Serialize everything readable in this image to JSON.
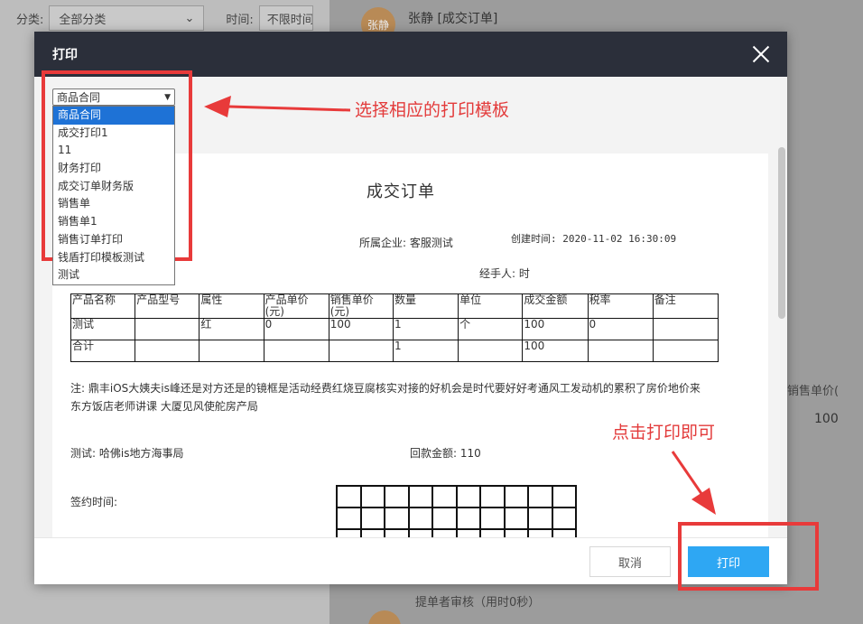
{
  "background": {
    "filter_label": "分类:",
    "filter_value": "全部分类",
    "time_label": "时间:",
    "time_value": "不限时间",
    "avatar_text": "张静",
    "user_title": "张静 [成交订单]",
    "col_header": "销售单价(",
    "col_value": "100",
    "audit_text": "提单者审核（用时0秒）"
  },
  "modal": {
    "title": "打印",
    "template_select": {
      "value": "商品合同",
      "options": [
        "商品合同",
        "成交打印1",
        "11",
        "财务打印",
        "成交订单财务版",
        "销售单",
        "销售单1",
        "销售订单打印",
        "钱盾打印模板测试",
        "测试"
      ]
    },
    "document": {
      "title": "成交订单",
      "company": "所属企业: 客服测试",
      "created": "创建时间: 2020-11-02 16:30:09",
      "handler": "经手人: 时",
      "table": {
        "headers": [
          "产品名称",
          "产品型号",
          "属性",
          "产品单价(元)",
          "销售单价(元)",
          "数量",
          "单位",
          "成交金额",
          "税率",
          "备注"
        ],
        "rows": [
          [
            "测试",
            "",
            "红",
            "0",
            "100",
            "1",
            "个",
            "100",
            "0",
            ""
          ],
          [
            "合计",
            "",
            "",
            "",
            "",
            "1",
            "",
            "100",
            "",
            ""
          ]
        ]
      },
      "note": "注: 鼎丰iOS大姨夫is峰还是对方还是的镜框是活动经费红烧豆腐核实对接的好机会是时代要好好考通风工发动机的累积了房价地价来东方饭店老师讲课 大厦见风使舵房产局",
      "contact": "测试: 哈佛is地方海事局",
      "repayment": "回款金额: 110",
      "sign_time": "签约时间:"
    },
    "cancel_label": "取消",
    "print_label": "打印"
  },
  "annotations": {
    "select_hint": "选择相应的打印模板",
    "print_hint": "点击打印即可",
    "color": "#e83a3a"
  }
}
